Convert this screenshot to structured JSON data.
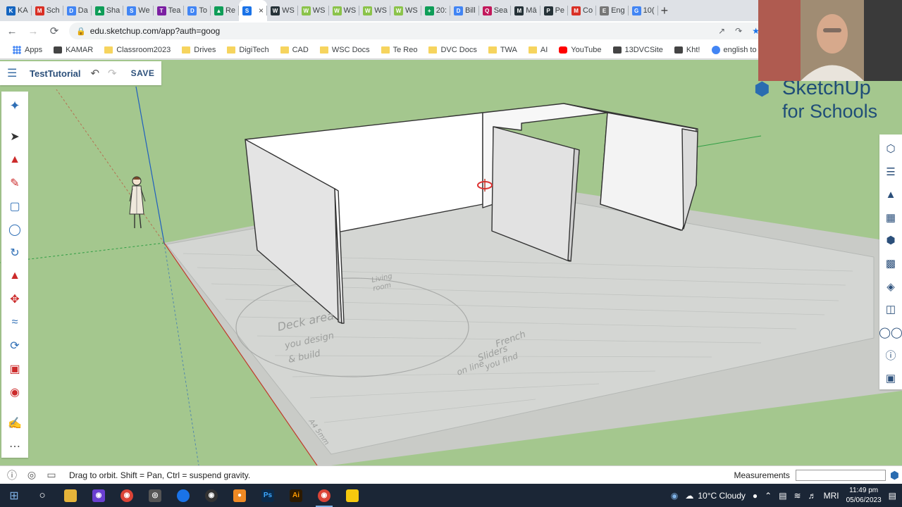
{
  "browser": {
    "tabs": [
      {
        "label": "KA",
        "color": "#1565c0",
        "glyph": "K"
      },
      {
        "label": "Sch",
        "color": "#d93025",
        "glyph": "M"
      },
      {
        "label": "Da",
        "color": "#4285f4",
        "glyph": "D"
      },
      {
        "label": "Sha",
        "color": "#0f9d58",
        "glyph": "▲"
      },
      {
        "label": "We",
        "color": "#4285f4",
        "glyph": "S"
      },
      {
        "label": "Tea",
        "color": "#7b1fa2",
        "glyph": "T"
      },
      {
        "label": "To",
        "color": "#4285f4",
        "glyph": "D"
      },
      {
        "label": "Re",
        "color": "#0f9d58",
        "glyph": "▲"
      },
      {
        "label": "",
        "color": "#1a73e8",
        "glyph": "S",
        "active": true
      },
      {
        "label": "WS",
        "color": "#263238",
        "glyph": "W"
      },
      {
        "label": "WS",
        "color": "#8bc34a",
        "glyph": "W"
      },
      {
        "label": "WS",
        "color": "#8bc34a",
        "glyph": "W"
      },
      {
        "label": "WS",
        "color": "#8bc34a",
        "glyph": "W"
      },
      {
        "label": "WS",
        "color": "#8bc34a",
        "glyph": "W"
      },
      {
        "label": "20:",
        "color": "#0f9d58",
        "glyph": "+"
      },
      {
        "label": "Bill",
        "color": "#4285f4",
        "glyph": "D"
      },
      {
        "label": "Sea",
        "color": "#c2185b",
        "glyph": "Q"
      },
      {
        "label": "Mā",
        "color": "#263238",
        "glyph": "M"
      },
      {
        "label": "Pe",
        "color": "#263238",
        "glyph": "P"
      },
      {
        "label": "Co",
        "color": "#d93025",
        "glyph": "M"
      },
      {
        "label": "Eng",
        "color": "#777777",
        "glyph": "E"
      },
      {
        "label": "10(",
        "color": "#4285f4",
        "glyph": "G"
      }
    ],
    "url": "edu.sketchup.com/app?auth=goog",
    "bookmarks": [
      {
        "label": "Apps",
        "type": "apps"
      },
      {
        "label": "KAMAR",
        "type": "site"
      },
      {
        "label": "Classroom2023",
        "type": "folder"
      },
      {
        "label": "Drives",
        "type": "folder"
      },
      {
        "label": "DigiTech",
        "type": "folder"
      },
      {
        "label": "CAD",
        "type": "folder"
      },
      {
        "label": "WSC Docs",
        "type": "folder"
      },
      {
        "label": "Te Reo",
        "type": "folder"
      },
      {
        "label": "DVC Docs",
        "type": "folder"
      },
      {
        "label": "TWA",
        "type": "folder"
      },
      {
        "label": "AI",
        "type": "folder"
      },
      {
        "label": "YouTube",
        "type": "youtube"
      },
      {
        "label": "13DVCSite",
        "type": "site"
      },
      {
        "label": "Kht!",
        "type": "site"
      },
      {
        "label": "english to maori tra...",
        "type": "google"
      }
    ]
  },
  "app": {
    "model_title": "TestTutorial",
    "save_label": "SAVE",
    "brand_name": "SketchUp",
    "brand_sub": "for Schools",
    "status_hint": "Drag to orbit. Shift = Pan, Ctrl = suspend gravity.",
    "measurements_label": "Measurements",
    "measurements_value": ""
  },
  "canvas": {
    "sketch_texts": [
      "Deck area",
      "you design",
      "& build",
      "French",
      "Sliders",
      "you find",
      "on line",
      "Living",
      "room",
      "A4 5mm"
    ]
  },
  "taskbar": {
    "weather": "10°C  Cloudy",
    "lang": "MRI",
    "time": "11:49 pm",
    "date": "05/06/2023"
  }
}
